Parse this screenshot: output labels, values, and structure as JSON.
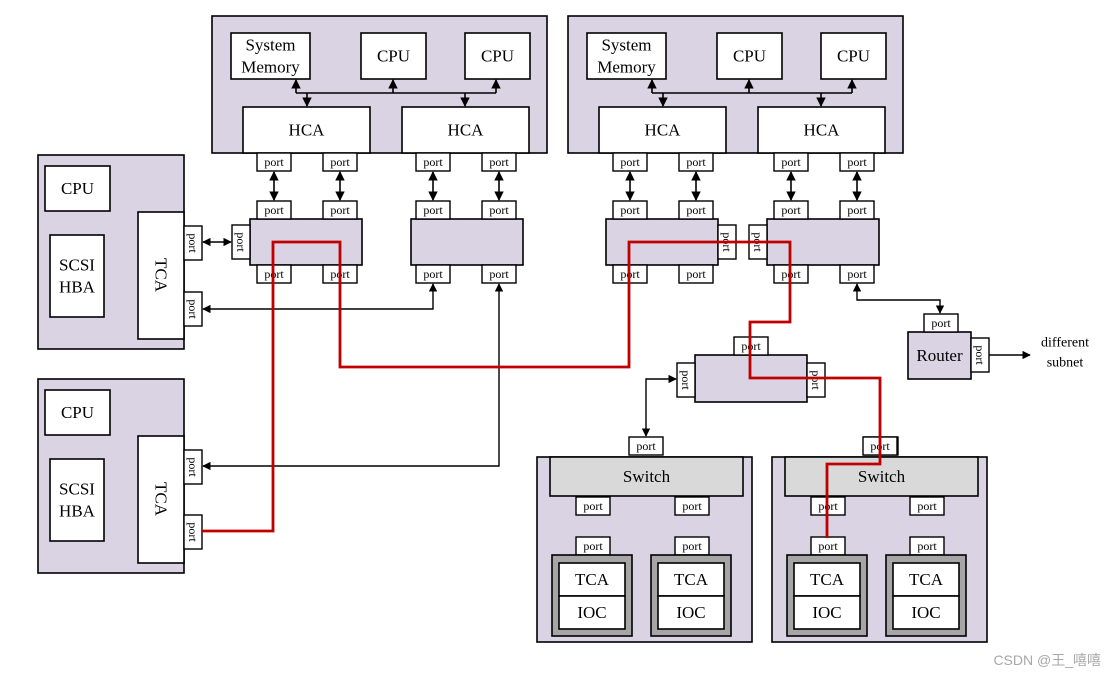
{
  "labels": {
    "system_memory": [
      "System",
      "Memory"
    ],
    "cpu": "CPU",
    "hca": "HCA",
    "port": "port",
    "tca": "TCA",
    "scsi_hba": [
      "SCSI",
      "HBA"
    ],
    "switch": "Switch",
    "router": "Router",
    "ioc": "IOC",
    "different_subnet": [
      "different",
      "subnet"
    ]
  },
  "watermark": "CSDN @王_嘻嘻",
  "colors": {
    "node_fill": "#d9d3e3",
    "switch_bar_fill": "#d9d9d9",
    "ioc_frame_fill": "#a6a6a6",
    "box_fill": "#ffffff",
    "path_highlight": "#c00000",
    "line": "#000000"
  }
}
